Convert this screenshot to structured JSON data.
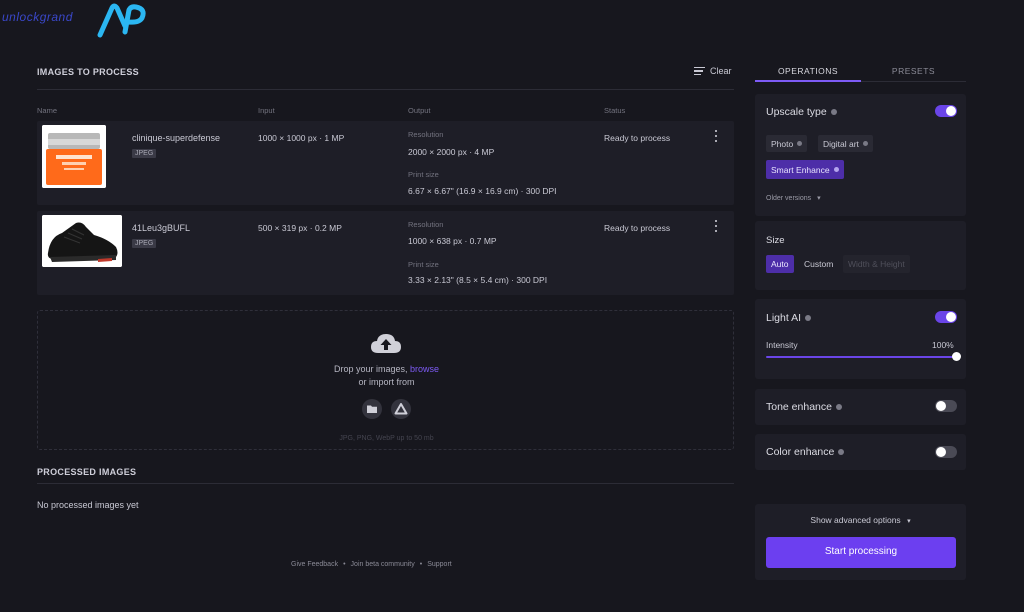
{
  "brand": {
    "logo_text": "unlockgrand",
    "logo_color": "#2bb7f2"
  },
  "left": {
    "images_title": "IMAGES TO PROCESS",
    "clear_label": "Clear",
    "columns": {
      "name": "Name",
      "input": "Input",
      "output": "Output",
      "status": "Status"
    },
    "rows": [
      {
        "name": "clinique-superdefense",
        "format": "JPEG",
        "input": "1000 × 1000 px · 1 MP",
        "resolution_label": "Resolution",
        "resolution": "2000 × 2000 px · 4 MP",
        "print_label": "Print size",
        "print": "6.67 × 6.67\" (16.9 × 16.9 cm) · 300 DPI",
        "status": "Ready to process",
        "thumb_icon": "cosmetic-jar-icon"
      },
      {
        "name": "41Leu3gBUFL",
        "format": "JPEG",
        "input": "500 × 319 px · 0.2 MP",
        "resolution_label": "Resolution",
        "resolution": "1000 × 638 px · 0.7 MP",
        "print_label": "Print size",
        "print": "3.33 × 2.13\" (8.5 × 5.4 cm) · 300 DPI",
        "status": "Ready to process",
        "thumb_icon": "sneaker-icon"
      }
    ],
    "dropzone": {
      "line1_prefix": "Drop your images,",
      "browse": "browse",
      "line2": "or import from",
      "formats": "JPG, PNG, WebP up to 50 mb"
    },
    "processed_title": "PROCESSED IMAGES",
    "processed_empty": "No processed images yet"
  },
  "footer": {
    "feedback": "Give Feedback",
    "community": "Join beta community",
    "support": "Support",
    "separator": "•"
  },
  "right": {
    "tabs": {
      "operations": "OPERATIONS",
      "presets": "PRESETS"
    },
    "upscale": {
      "title": "Upscale type",
      "enabled": true,
      "options": [
        "Photo",
        "Digital art",
        "Smart Enhance"
      ],
      "selected": "Smart Enhance",
      "older": "Older versions"
    },
    "size": {
      "title": "Size",
      "options": [
        "Auto",
        "Custom",
        "Width & Height"
      ],
      "selected": "Auto"
    },
    "light_ai": {
      "title": "Light AI",
      "enabled": true,
      "intensity_label": "Intensity",
      "intensity_value": "100%"
    },
    "tone": {
      "title": "Tone enhance",
      "enabled": false
    },
    "color": {
      "title": "Color enhance",
      "enabled": false
    },
    "advanced": "Show advanced options",
    "start": "Start processing"
  },
  "colors": {
    "accent": "#6c3ff0",
    "background": "#17171e",
    "card": "#1e1e27"
  }
}
